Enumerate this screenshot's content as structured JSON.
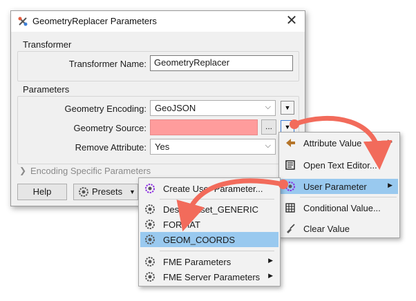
{
  "dialog": {
    "title": "GeometryReplacer Parameters",
    "close_glyph": "✕",
    "transformer_group": "Transformer",
    "transformer_name_label": "Transformer Name:",
    "transformer_name_value": "GeometryReplacer",
    "parameters_group": "Parameters",
    "geometry_encoding_label": "Geometry Encoding:",
    "geometry_encoding_value": "GeoJSON",
    "geometry_source_label": "Geometry Source:",
    "geometry_source_value": "",
    "remove_attribute_label": "Remove Attribute:",
    "remove_attribute_value": "Yes",
    "encoding_specific_label": "Encoding Specific Parameters",
    "ellipsis_label": "...",
    "help_label": "Help",
    "presets_label": "Presets"
  },
  "context_menu": {
    "items": [
      {
        "label": "Attribute Value",
        "icon": "attribute-value-icon",
        "submenu": true
      },
      {
        "label": "Open Text Editor...",
        "icon": "text-editor-icon",
        "submenu": false
      },
      {
        "label": "User Parameter",
        "icon": "user-parameter-icon",
        "submenu": true,
        "highlighted": true
      },
      {
        "label": "Conditional Value...",
        "icon": "table-icon",
        "submenu": false
      },
      {
        "label": "Clear Value",
        "icon": "broom-icon",
        "submenu": false
      }
    ]
  },
  "user_param_menu": {
    "items": [
      {
        "label": "Create User Parameter...",
        "submenu": false
      },
      {
        "label": "DestDataset_GENERIC",
        "submenu": false
      },
      {
        "label": "FORMAT",
        "submenu": false
      },
      {
        "label": "GEOM_COORDS",
        "submenu": false,
        "highlighted": true
      },
      {
        "label": "FME Parameters",
        "submenu": true
      },
      {
        "label": "FME Server Parameters",
        "submenu": true
      }
    ]
  },
  "colors": {
    "required_field": "#ff9c9c",
    "highlight": "#99c9ef",
    "annotation_arrow": "#f26b5b"
  }
}
